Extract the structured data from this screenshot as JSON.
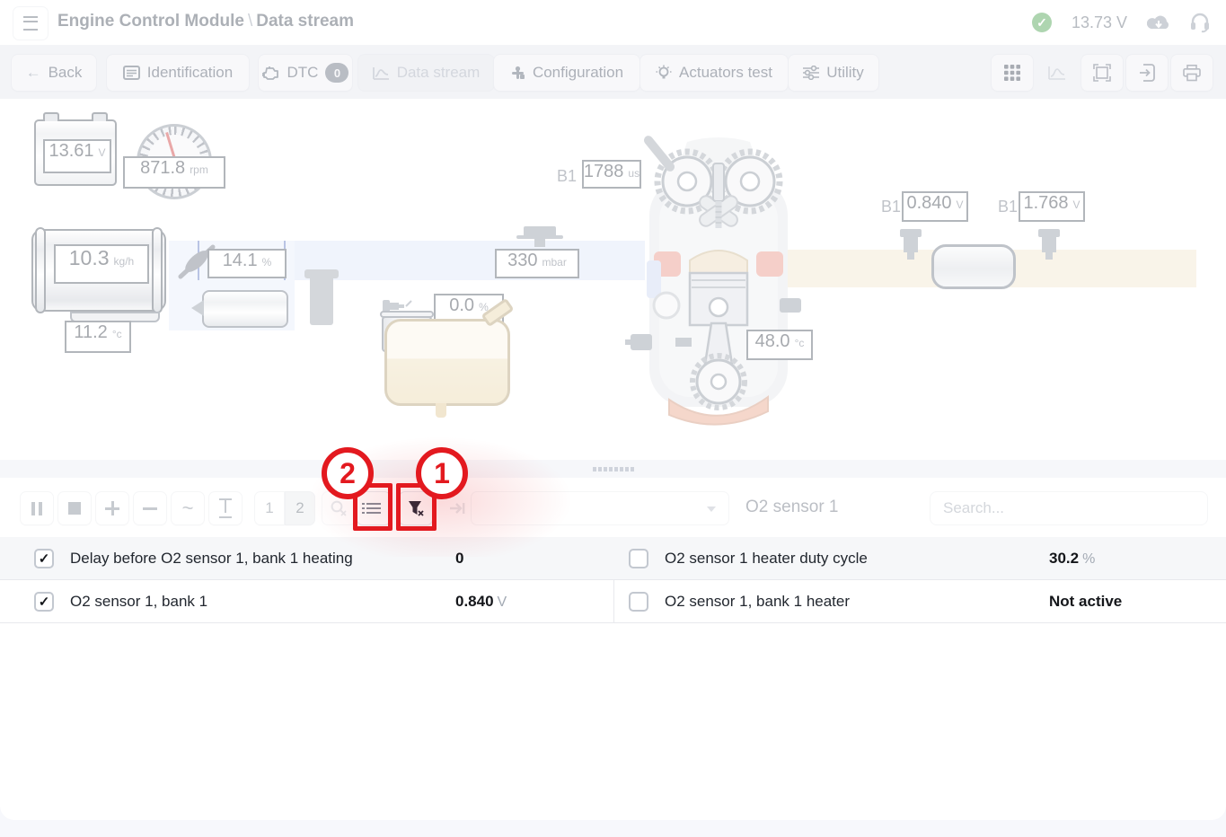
{
  "header": {
    "title": "Engine Control Module",
    "separator": "\\",
    "section": "Data stream",
    "voltage": "13.73 V",
    "status_icon": "✓"
  },
  "tabs": {
    "back": "Back",
    "back_arrow": "←",
    "identification": "Identification",
    "dtc": "DTC",
    "dtc_badge": "0",
    "data_stream": "Data stream",
    "configuration": "Configuration",
    "actuators": "Actuators test",
    "utility": "Utility"
  },
  "diagram": {
    "battery": {
      "value": "13.61",
      "unit": "V"
    },
    "rpm": {
      "value": "871.8",
      "unit": "rpm"
    },
    "maf": {
      "value": "10.3",
      "unit": "kg/h"
    },
    "intake_temp": {
      "value": "11.2",
      "unit": "°c"
    },
    "throttle": {
      "value": "14.1",
      "unit": "%"
    },
    "injection": {
      "bank": "B1",
      "value": "1788",
      "unit": "us"
    },
    "map": {
      "value": "330",
      "unit": "mbar"
    },
    "purge": {
      "value": "0.0",
      "unit": "%"
    },
    "coolant": {
      "value": "48.0",
      "unit": "°c"
    },
    "o2_sensor_1": {
      "bank": "B1",
      "value": "0.840",
      "unit": "V"
    },
    "o2_sensor_2": {
      "bank": "B1",
      "value": "1.768",
      "unit": "V"
    }
  },
  "toolbar": {
    "page1": "1",
    "page2": "2",
    "wave": "~",
    "group_label": "O2 sensor 1",
    "search_placeholder": "Search..."
  },
  "annotations": {
    "step1": "1",
    "step2": "2"
  },
  "table": {
    "rows": [
      {
        "left_checked": "✓",
        "left_label": "Delay before O2 sensor 1, bank 1 heating",
        "left_value": "0",
        "left_unit": "",
        "right_label": "O2 sensor 1 heater duty cycle",
        "right_value": "30.2",
        "right_unit": "%"
      },
      {
        "left_checked": "✓",
        "left_label": "O2 sensor 1, bank 1",
        "left_value": "0.840",
        "left_unit": "V",
        "right_label": "O2 sensor 1, bank 1 heater",
        "right_value": "Not active",
        "right_unit": ""
      }
    ]
  },
  "colors": {
    "annotation_red": "#e3191f",
    "status_green": "#3f9d46"
  }
}
